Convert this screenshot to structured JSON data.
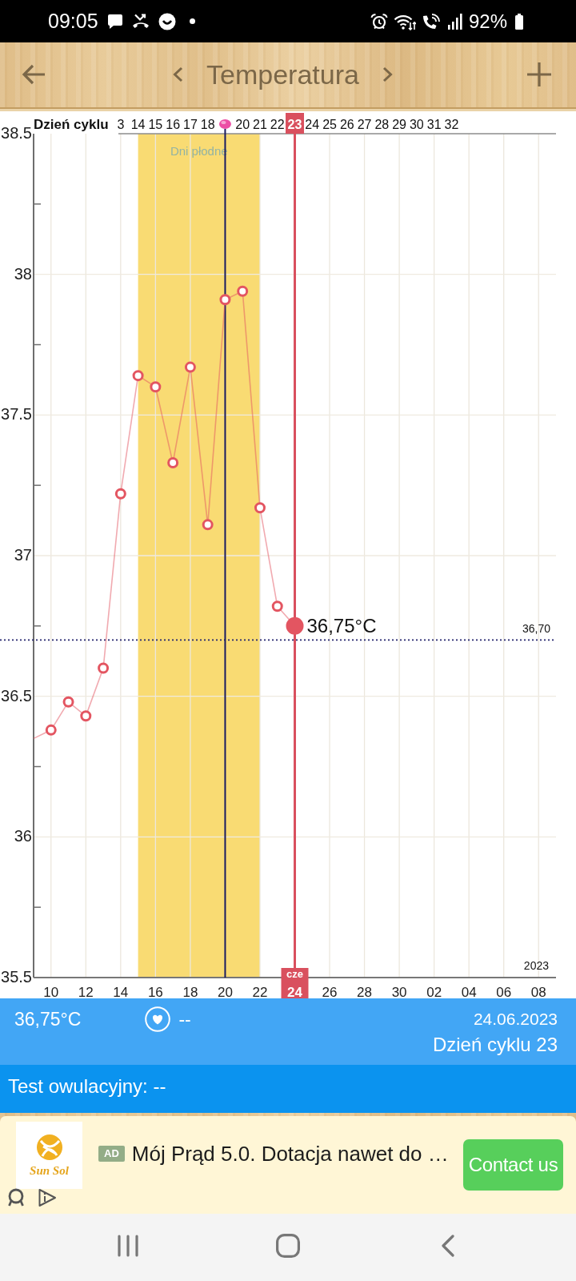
{
  "status_bar": {
    "time": "09:05",
    "battery": "92%"
  },
  "header": {
    "title": "Temperatura"
  },
  "chart": {
    "cycle_row": {
      "title": "Dzień cyklu",
      "ticks": [
        {
          "kind": "day",
          "label": "3",
          "selected": false
        },
        {
          "kind": "day",
          "label": "14",
          "selected": false
        },
        {
          "kind": "day",
          "label": "15",
          "selected": false
        },
        {
          "kind": "day",
          "label": "16",
          "selected": false
        },
        {
          "kind": "day",
          "label": "17",
          "selected": false
        },
        {
          "kind": "day",
          "label": "18",
          "selected": false
        },
        {
          "kind": "ovulation",
          "selected": false
        },
        {
          "kind": "day",
          "label": "20",
          "selected": false
        },
        {
          "kind": "day",
          "label": "21",
          "selected": false
        },
        {
          "kind": "day",
          "label": "22",
          "selected": false
        },
        {
          "kind": "day",
          "label": "23",
          "selected": true
        },
        {
          "kind": "day",
          "label": "24",
          "selected": false
        },
        {
          "kind": "day",
          "label": "25",
          "selected": false
        },
        {
          "kind": "day",
          "label": "26",
          "selected": false
        },
        {
          "kind": "day",
          "label": "27",
          "selected": false
        },
        {
          "kind": "day",
          "label": "28",
          "selected": false
        },
        {
          "kind": "day",
          "label": "29",
          "selected": false
        },
        {
          "kind": "day",
          "label": "30",
          "selected": false
        },
        {
          "kind": "day",
          "label": "31",
          "selected": false
        },
        {
          "kind": "day",
          "label": "32",
          "selected": false
        }
      ]
    },
    "year": "2023",
    "chart_data": {
      "type": "line",
      "grid": true,
      "xlim": [
        "2023-06-09",
        "2023-07-09"
      ],
      "ylim": [
        35.5,
        38.5
      ],
      "x": [
        "2023-06-09",
        "2023-06-10",
        "2023-06-11",
        "2023-06-12",
        "2023-06-13",
        "2023-06-14",
        "2023-06-15",
        "2023-06-16",
        "2023-06-17",
        "2023-06-18",
        "2023-06-19",
        "2023-06-20",
        "2023-06-21",
        "2023-06-22",
        "2023-06-23",
        "2023-06-24"
      ],
      "series": [
        {
          "color": "#e35561",
          "marker": "o",
          "values": [
            36.35,
            36.38,
            36.48,
            36.43,
            36.6,
            37.22,
            37.64,
            37.6,
            37.33,
            37.67,
            37.11,
            37.91,
            37.94,
            37.17,
            36.82,
            36.75
          ]
        }
      ],
      "xticks": [
        {
          "value": "2023-06-10",
          "label": "10"
        },
        {
          "value": "2023-06-12",
          "label": "12"
        },
        {
          "value": "2023-06-14",
          "label": "14"
        },
        {
          "value": "2023-06-16",
          "label": "16"
        },
        {
          "value": "2023-06-18",
          "label": "18"
        },
        {
          "value": "2023-06-20",
          "label": "20"
        },
        {
          "value": "2023-06-22",
          "label": "22"
        },
        {
          "value": "2023-06-24",
          "label": "24"
        },
        {
          "value": "2023-06-26",
          "label": "26"
        },
        {
          "value": "2023-06-28",
          "label": "28"
        },
        {
          "value": "2023-06-30",
          "label": "30"
        },
        {
          "value": "2023-07-02",
          "label": "02"
        },
        {
          "value": "2023-07-04",
          "label": "04"
        },
        {
          "value": "2023-07-06",
          "label": "06"
        },
        {
          "value": "2023-07-08",
          "label": "08"
        }
      ],
      "yticks": [
        {
          "value": 38.5,
          "label": "38.5"
        },
        {
          "value": 38,
          "label": "38"
        },
        {
          "value": 37.5,
          "label": "37.5"
        },
        {
          "value": 37,
          "label": "37"
        },
        {
          "value": 36.5,
          "label": "36.5"
        },
        {
          "value": 36,
          "label": "36"
        },
        {
          "value": 35.5,
          "label": "35.5"
        }
      ],
      "bands": [
        {
          "axis": "x",
          "from": "2023-06-15",
          "to": "2023-06-22",
          "label": "Dni płodne",
          "color": "#f9db73"
        }
      ],
      "ref_lines": [
        {
          "axis": "y",
          "value": 36.7,
          "label": "36,70",
          "color": "#24246e"
        },
        {
          "axis": "x",
          "value": "2023-06-20",
          "color": "#1b1b5c"
        },
        {
          "axis": "x",
          "value": "2023-06-24",
          "label": "cze",
          "color": "#d9505e"
        }
      ],
      "annotations": [
        {
          "x": "2023-06-24",
          "y": 36.75,
          "text": "36,75°C"
        }
      ]
    }
  },
  "summary": {
    "temperature": "36,75°C",
    "heart_value": "--",
    "date": "24.06.2023",
    "cycle_day": "Dzień cyklu 23"
  },
  "ovulation_test": {
    "text": "Test owulacyjny: --"
  },
  "ad": {
    "logo_text": "Sun Sol",
    "badge": "AD",
    "headline": "Mój Prąd 5.0. Dotacja nawet do …",
    "button": "Contact us"
  }
}
